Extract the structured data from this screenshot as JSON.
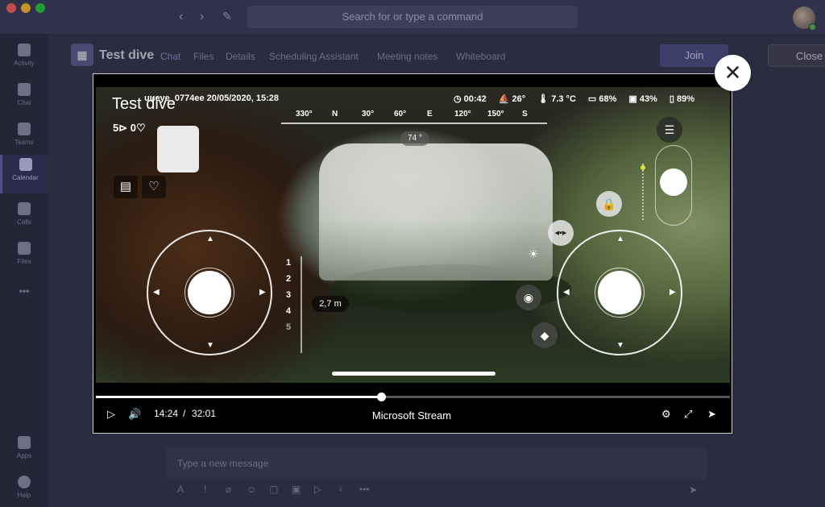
{
  "titlebar": {
    "search_placeholder": "Search for or type a command",
    "back_icon": "‹",
    "forward_icon": "›",
    "compose_icon": "✎"
  },
  "rail": {
    "items": [
      {
        "label": "Activity",
        "icon": "bell-icon"
      },
      {
        "label": "Chat",
        "icon": "chat-icon"
      },
      {
        "label": "Teams",
        "icon": "teams-icon"
      },
      {
        "label": "Calendar",
        "icon": "calendar-icon",
        "active": true
      },
      {
        "label": "Calls",
        "icon": "phone-icon"
      },
      {
        "label": "Files",
        "icon": "file-icon"
      }
    ],
    "more": "•••",
    "apps": "Apps",
    "help": "Help"
  },
  "meeting": {
    "title": "Test dive",
    "tabs": [
      "Chat",
      "Files",
      "Details",
      "Scheduling Assistant",
      "Meeting notes",
      "Whiteboard"
    ],
    "join_label": "Join",
    "close_label": "Close"
  },
  "compose": {
    "placeholder": "Type a new message"
  },
  "video": {
    "title": "Test dive",
    "counts": "5⊳ 0♡",
    "topline": "uueye_0774ee  20/05/2020, 15:28",
    "stats": [
      "◷ 00:42",
      "⛵ 26°",
      "🌡 7.3 °C",
      "▭ 68%",
      "▣ 43%",
      "▯ 89%"
    ],
    "compass": [
      "330°",
      "N",
      "30°",
      "60°",
      "E",
      "120°",
      "150°",
      "S"
    ],
    "heading": "74 °",
    "depth_scale": [
      "1",
      "2",
      "3",
      "4",
      "5"
    ],
    "depth": "2,7 m"
  },
  "player": {
    "current_time": "14:24",
    "separator": "/",
    "duration": "32:01",
    "source": "Microsoft Stream",
    "progress": 0.45
  }
}
